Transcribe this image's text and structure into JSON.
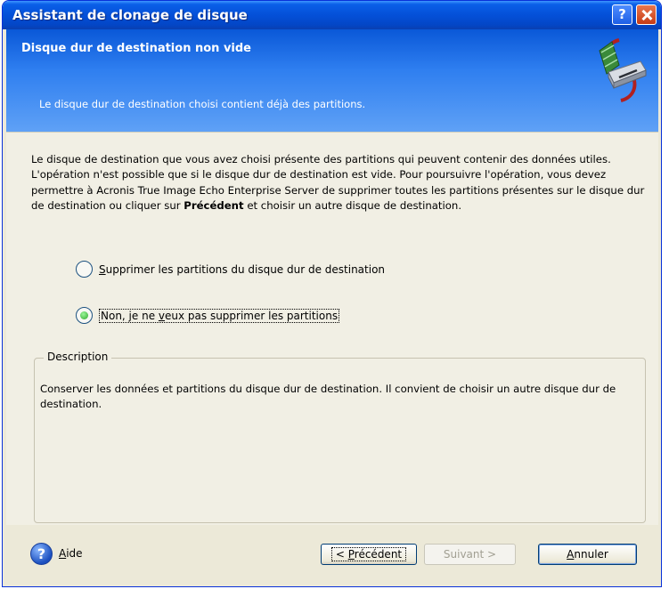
{
  "window": {
    "title": "Assistant de clonage de disque",
    "help_button": "?"
  },
  "header": {
    "title": "Disque dur de destination non vide",
    "subtitle": "Le disque dur de destination choisi contient déjà des partitions.",
    "icon": "disk-clone-icon"
  },
  "content": {
    "intro_text": "Le disque de destination que vous avez choisi présente des partitions qui peuvent contenir des données utiles. L'opération n'est possible que si le disque dur de destination est vide. Pour poursuivre l'opération, vous devez permettre à Acronis True Image Echo Enterprise Server de supprimer toutes les partitions présentes sur le disque dur de destination ou cliquer sur",
    "intro_bold": "Précédent",
    "intro_end": "et choisir un autre disque de destination.",
    "options": [
      {
        "mnemonic": "S",
        "rest": "upprimer les partitions du disque dur de destination",
        "selected": false
      },
      {
        "prefix": "Non, je ne ",
        "mnemonic": "v",
        "rest": "eux pas supprimer les partitions",
        "selected": true
      }
    ]
  },
  "description": {
    "legend": "Description",
    "text": "Conserver les données et partitions du disque dur de destination. Il convient de choisir un autre disque dur de destination."
  },
  "footer": {
    "help": {
      "mnemonic": "A",
      "rest": "ide",
      "icon": "help-icon"
    },
    "prev": {
      "lead": "< ",
      "mnemonic": "P",
      "rest": "récédent"
    },
    "next": {
      "label": "Suivant >",
      "enabled": false
    },
    "cancel": {
      "mnemonic": "A",
      "rest": "nnuler"
    }
  }
}
